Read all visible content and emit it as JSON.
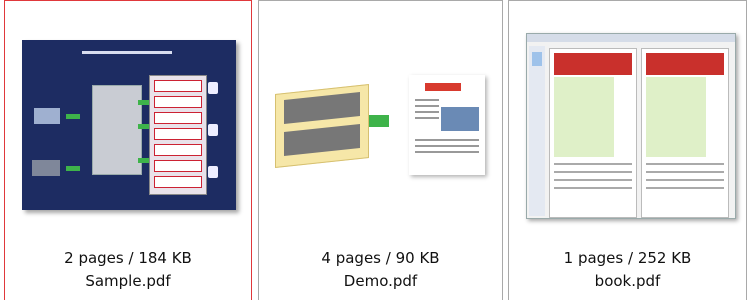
{
  "files": [
    {
      "pages": "2 pages / 184 KB",
      "name": "Sample.pdf",
      "selected": true
    },
    {
      "pages": "4 pages / 90 KB",
      "name": "Demo.pdf",
      "selected": false
    },
    {
      "pages": "1 pages / 252 KB",
      "name": "book.pdf",
      "selected": false
    }
  ],
  "colors": {
    "selection_border": "#e0383b",
    "tile_border": "#a9a9a9"
  }
}
